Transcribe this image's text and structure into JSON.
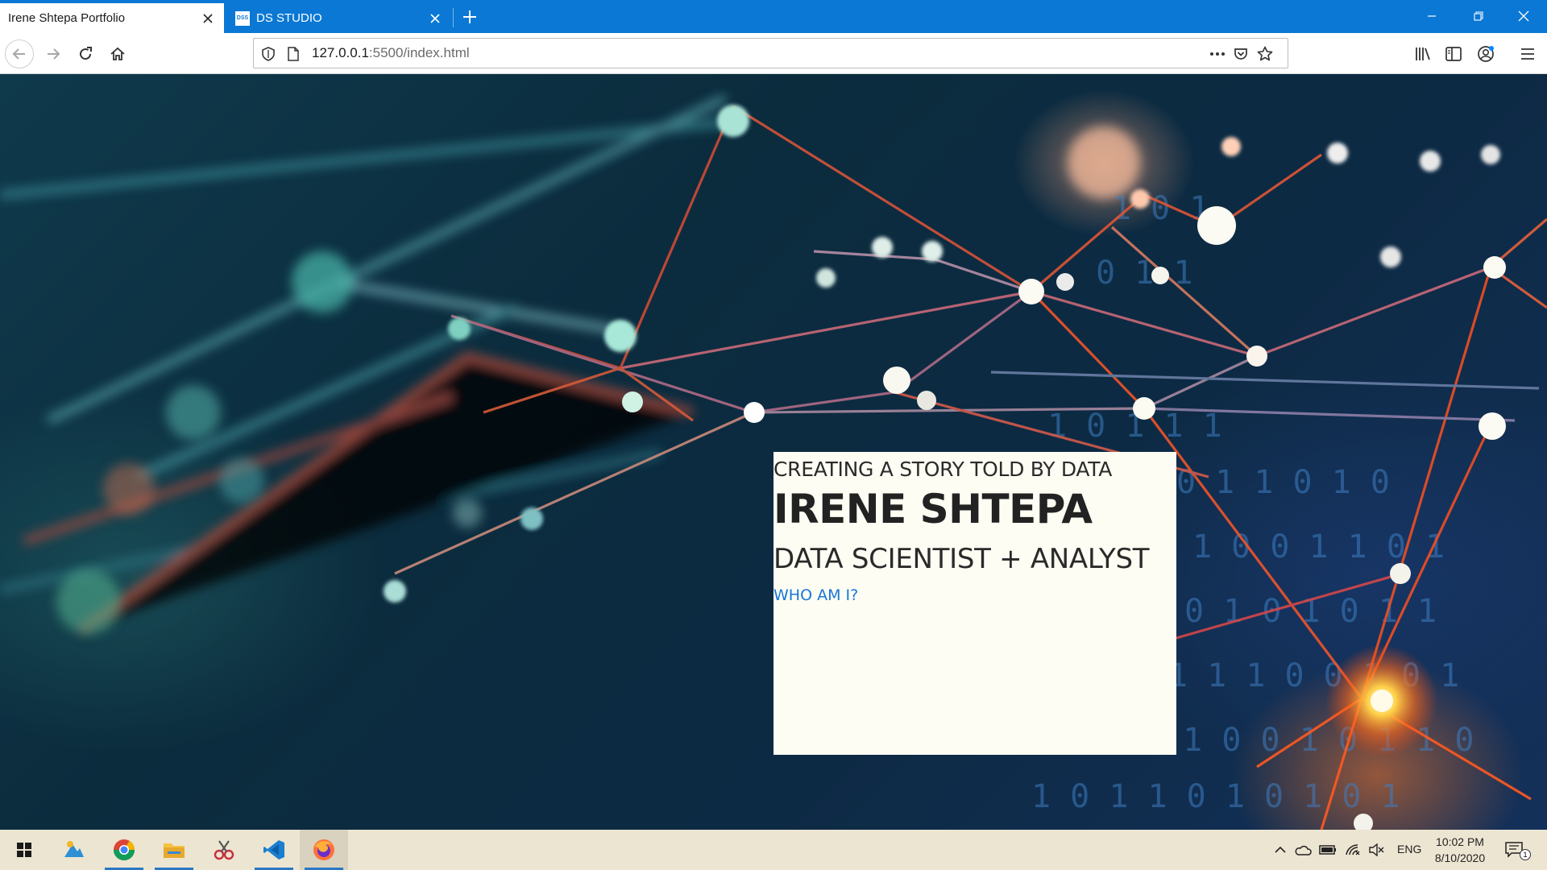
{
  "browser": {
    "tabs": [
      {
        "label": "Irene Shtepa Portfolio",
        "active": true
      },
      {
        "label": "DS STUDIO",
        "active": false,
        "favicon_text": "DSS"
      }
    ],
    "url": {
      "host": "127.0.0.1",
      "path": ":5500/index.html"
    },
    "icons": {
      "back": "back-arrow-icon",
      "forward": "forward-arrow-icon",
      "reload": "reload-icon",
      "home": "home-icon",
      "shield": "tracking-shield-icon",
      "page": "page-icon",
      "more": "more-dots-icon",
      "pocket": "pocket-icon",
      "bookmark": "star-icon",
      "library": "library-icon",
      "sidebar": "sidebar-icon",
      "account": "account-icon",
      "menu": "hamburger-menu-icon"
    },
    "colors": {
      "titlebar": "#0a78d4",
      "link": "#1777d8"
    }
  },
  "hero": {
    "kicker": "CREATING A STORY TOLD BY DATA",
    "name": "IRENE SHTEPA",
    "role": "DATA SCIENTIST + ANALYST",
    "link": "WHO AM I?"
  },
  "taskbar": {
    "apps": [
      "start-icon",
      "photos-app-icon",
      "chrome-icon",
      "file-explorer-icon",
      "snipping-tool-icon",
      "vscode-icon",
      "firefox-icon"
    ],
    "tray": {
      "language": "ENG",
      "time": "10:02 PM",
      "date": "8/10/2020",
      "notifications": "1"
    }
  }
}
